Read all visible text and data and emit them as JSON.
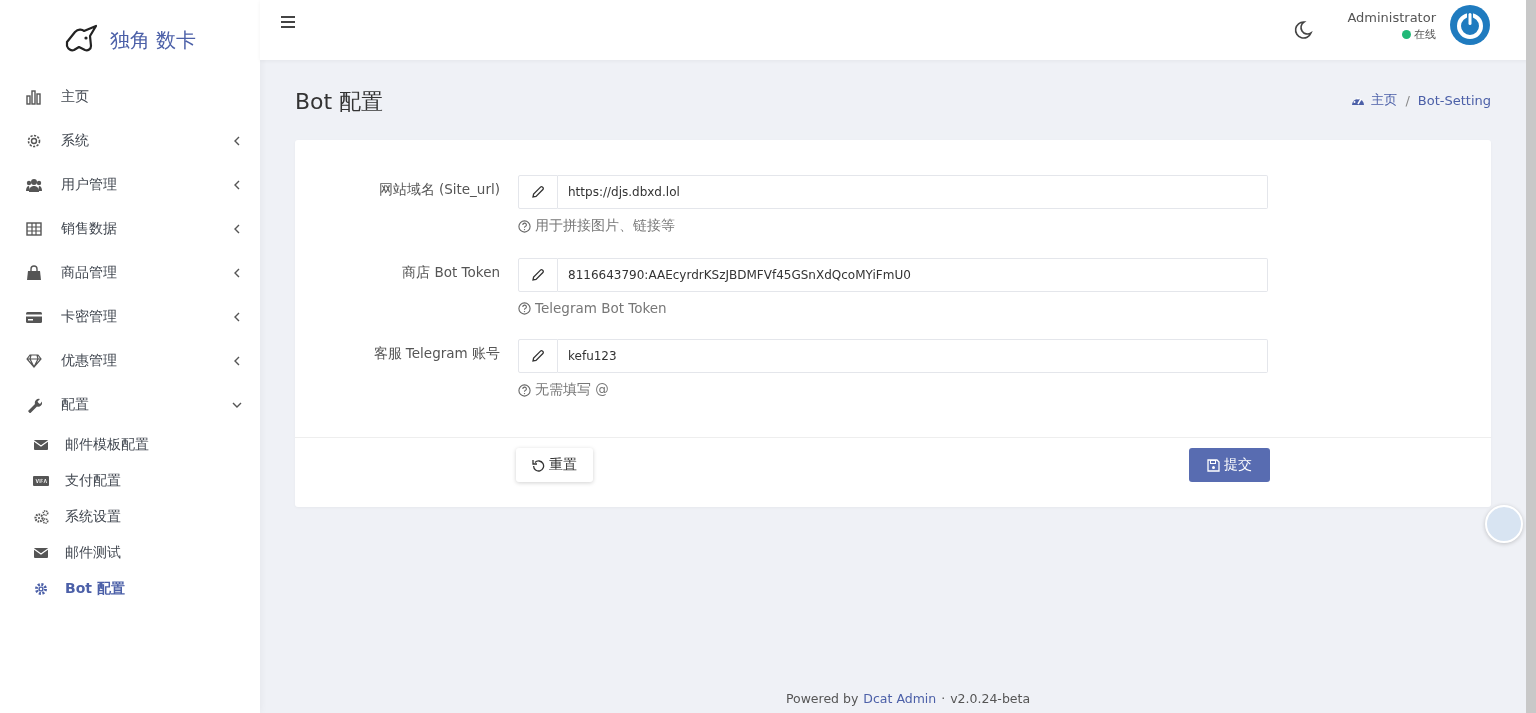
{
  "brand": {
    "name": "独角 数卡"
  },
  "sidebar": {
    "items": [
      {
        "label": "主页"
      },
      {
        "label": "系统",
        "expanded": false
      },
      {
        "label": "用户管理",
        "expanded": false
      },
      {
        "label": "销售数据",
        "expanded": false
      },
      {
        "label": "商品管理",
        "expanded": false
      },
      {
        "label": "卡密管理",
        "expanded": false
      },
      {
        "label": "优惠管理",
        "expanded": false
      },
      {
        "label": "配置",
        "expanded": true,
        "children": [
          {
            "label": "邮件模板配置",
            "selected": false
          },
          {
            "label": "支付配置",
            "selected": false
          },
          {
            "label": "系统设置",
            "selected": false
          },
          {
            "label": "邮件测试",
            "selected": false
          },
          {
            "label": "Bot 配置",
            "selected": true
          }
        ]
      }
    ]
  },
  "user": {
    "name": "Administrator",
    "status": "在线",
    "online": true
  },
  "page": {
    "title": "Bot 配置",
    "breadcrumb": [
      "主页",
      "Bot-Setting"
    ],
    "breadcrumb_separator": "/"
  },
  "form": {
    "fields": [
      {
        "label": "网站域名 (Site_url)",
        "value": "https://djs.dbxd.lol",
        "help": "用于拼接图片、链接等"
      },
      {
        "label": "商店 Bot Token",
        "value": "8116643790:AAEcyrdrKSzJBDMFVf45GSnXdQcoMYiFmU0",
        "help": "Telegram Bot Token"
      },
      {
        "label": "客服 Telegram 账号",
        "value": "kefu123",
        "help": "无需填写 @"
      }
    ],
    "buttons": [
      {
        "label": "重置",
        "kind": "reset"
      },
      {
        "label": "提交",
        "kind": "submit"
      }
    ]
  },
  "footer": {
    "prefix": "Powered by",
    "link": "Dcat Admin",
    "separator": "·",
    "version": "v2.0.24-beta"
  }
}
